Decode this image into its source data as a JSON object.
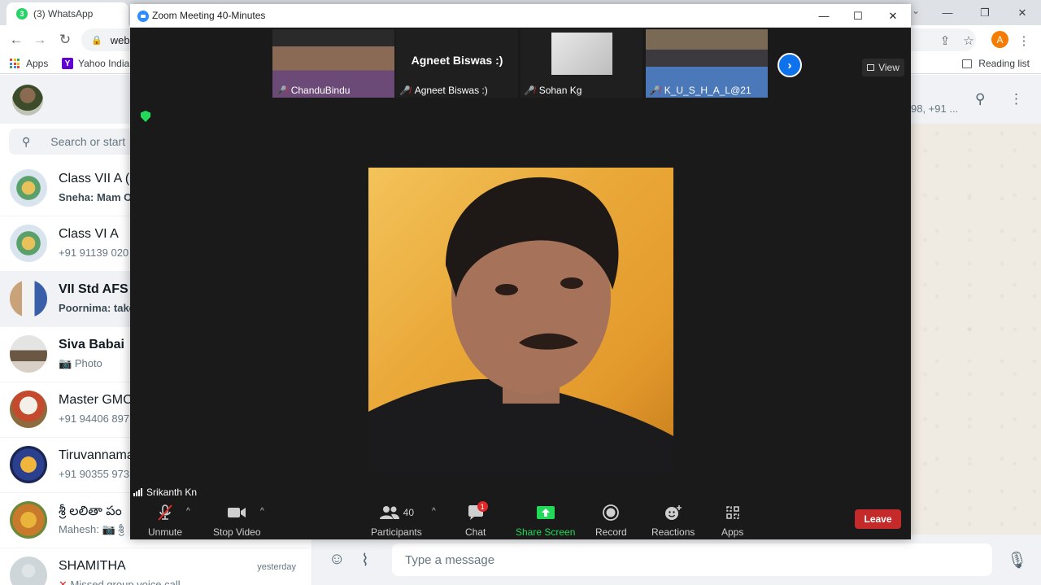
{
  "browser": {
    "tab_title": "(3) WhatsApp",
    "tab_badge": "3",
    "url_fragment": "web.",
    "bookmarks": {
      "apps": "Apps",
      "yahoo": "Yahoo India",
      "reading_list": "Reading list"
    },
    "profile_initial": "A"
  },
  "whatsapp": {
    "search_placeholder": "Search or start",
    "header_members": "98, +91 ...",
    "message_placeholder": "Type a message",
    "chats": [
      {
        "name": "Class VII A (2",
        "preview": "Sneha: Mam O",
        "time": ""
      },
      {
        "name": "Class VI A",
        "preview": "+91 91139 020",
        "time": ""
      },
      {
        "name": "VII Std AFS y",
        "preview": "Poornima: take",
        "time": ""
      },
      {
        "name": "Siva Babai",
        "preview": "Photo",
        "time": ""
      },
      {
        "name": "Master GMC",
        "preview": "+91 94406 897",
        "time": ""
      },
      {
        "name": "Tiruvannama",
        "preview": "+91 90355 973",
        "time": ""
      },
      {
        "name": "శ్రీ లలితా పం",
        "preview": "Mahesh: 📷 శ్రీ",
        "time": ""
      },
      {
        "name": "SHAMITHA",
        "preview": "Missed group voice call",
        "time": "yesterday"
      }
    ]
  },
  "zoom": {
    "window_title": "Zoom Meeting 40-Minutes",
    "view_label": "View",
    "thumbnails": [
      {
        "name": "ChanduBindu"
      },
      {
        "name": "Agneet Biswas :)",
        "center_name": "Agneet Biswas :)"
      },
      {
        "name": "Sohan Kg"
      },
      {
        "name": "K_U_S_H_A_L@21"
      }
    ],
    "active_speaker": "Srikanth Kn",
    "toolbar": {
      "unmute": "Unmute",
      "stop_video": "Stop Video",
      "participants": "Participants",
      "participants_count": "40",
      "chat": "Chat",
      "chat_badge": "1",
      "share_screen": "Share Screen",
      "record": "Record",
      "reactions": "Reactions",
      "apps": "Apps",
      "leave": "Leave"
    },
    "colors": {
      "share_green": "#23d959",
      "leave_red": "#c52a2a",
      "brand_blue": "#2d8cff"
    }
  }
}
